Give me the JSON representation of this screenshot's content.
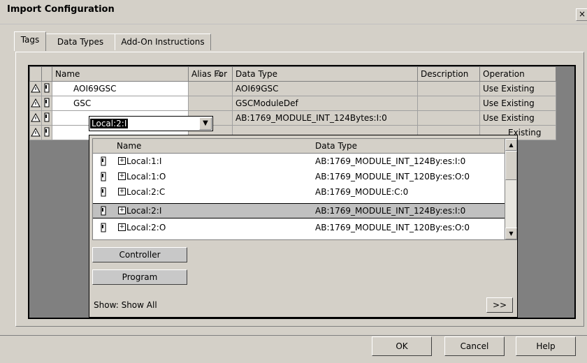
{
  "window": {
    "title": "Import Configuration",
    "close_glyph": "×"
  },
  "tabs": [
    "Tags",
    "Data Types",
    "Add-On Instructions"
  ],
  "grid": {
    "columns": [
      "Name",
      "Alias For",
      "Data Type",
      "Description",
      "Operation"
    ],
    "sort_indicator": "△",
    "rows": [
      {
        "name": "AOI69GSC",
        "alias": "",
        "type": "AOI69GSC",
        "desc": "",
        "op": "Use Existing"
      },
      {
        "name": "GSC",
        "alias": "",
        "type": "GSCModuleDef",
        "desc": "",
        "op": "Use Existing"
      },
      {
        "name": "Local:2:I",
        "alias": "",
        "type": "AB:1769_MODULE_INT_124Bytes:I:0",
        "desc": "",
        "op": "Use Existing"
      },
      {
        "name": "",
        "alias": "",
        "type": "",
        "desc": "",
        "op": "Existing"
      }
    ]
  },
  "dropdown": {
    "columns": [
      "Name",
      "Data Type"
    ],
    "items": [
      {
        "name": "Local:1:I",
        "type": "AB:1769_MODULE_INT_124By:es:I:0",
        "selected": false
      },
      {
        "name": "Local:1:O",
        "type": "AB:1769_MODULE_INT_120By:es:O:0",
        "selected": false
      },
      {
        "name": "Local:2:C",
        "type": "AB:1769_MODULE:C:0",
        "selected": false
      },
      {
        "name": "Local:2:I",
        "type": "AB:1769_MODULE_INT_124By:es:I:0",
        "selected": true
      },
      {
        "name": "Local:2:O",
        "type": "AB:1769_MODULE_INT_120By:es:O:0",
        "selected": false
      }
    ],
    "scope_buttons": [
      "Controller",
      "Program"
    ],
    "show_label": "Show: Show All",
    "more_button": ">>"
  },
  "buttons": {
    "ok": "OK",
    "cancel": "Cancel",
    "help": "Help"
  }
}
